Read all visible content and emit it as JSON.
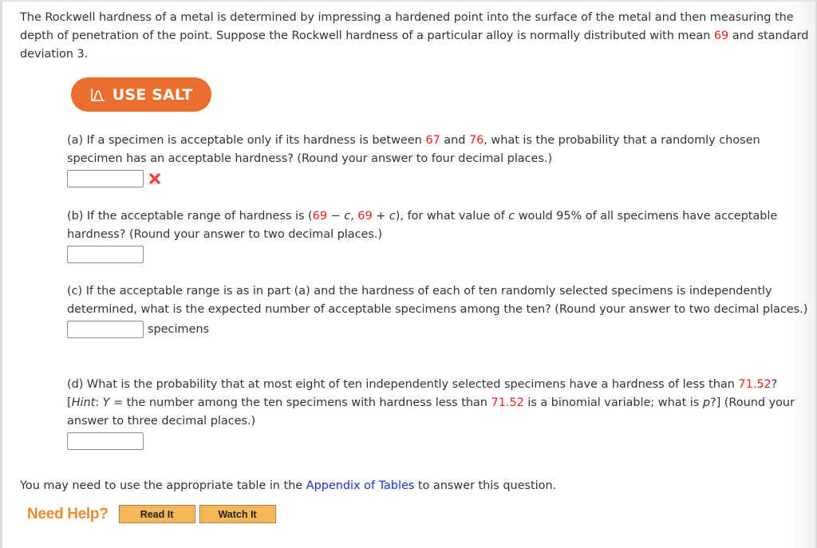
{
  "intro": {
    "text_1": "The Rockwell hardness of a metal is determined by impressing a hardened point into the surface of the metal and then measuring the depth of penetration of the point. Suppose the Rockwell hardness of a particular alloy is normally distributed with mean ",
    "mean": "69",
    "text_2": " and standard deviation 3."
  },
  "salt_button": {
    "label": "USE SALT",
    "icon": "salt-curve-icon"
  },
  "part_a": {
    "text_1": "(a) If a specimen is acceptable only if its hardness is between ",
    "low": "67",
    "text_2": " and ",
    "high": "76",
    "text_3": ", what is the probability that a randomly chosen specimen has an acceptable hardness? (Round your answer to four decimal places.)",
    "answer_value": "",
    "status_icon": "wrong-x-icon",
    "status_color": "#e8474b"
  },
  "part_b": {
    "text_1": "(b) If the acceptable range of hardness is (",
    "mean_1": "69",
    "text_2": " − ",
    "var_1": "c",
    "text_3": ", ",
    "mean_2": "69",
    "text_4": " + ",
    "var_2": "c",
    "text_5": "), for what value of ",
    "var_3": "c",
    "text_6": " would 95% of all specimens have acceptable hardness? (Round your answer to two decimal places.)",
    "answer_value": ""
  },
  "part_c": {
    "text": "(c) If the acceptable range is as in part (a) and the hardness of each of ten randomly selected specimens is independently determined, what is the expected number of acceptable specimens among the ten? (Round your answer to two decimal places.)",
    "answer_value": "",
    "unit": "specimens"
  },
  "part_d": {
    "text_1": "(d) What is the probability that at most eight of ten independently selected specimens have a hardness of less than ",
    "value_1": "71.52",
    "text_2": "? [",
    "hint_label": "Hint",
    "text_3": ": ",
    "var_y": "Y",
    "text_4": " = the number among the ten specimens with hardness less than ",
    "value_2": "71.52",
    "text_5": " is a binomial variable; what is ",
    "var_p": "p",
    "text_6": "?] (Round your answer to three decimal places.)",
    "answer_value": ""
  },
  "appendix": {
    "text_1": "You may need to use the appropriate table in the ",
    "link": "Appendix of Tables",
    "text_2": " to answer this question."
  },
  "help": {
    "label": "Need Help?",
    "buttons": [
      "Read It",
      "Watch It"
    ]
  },
  "colors": {
    "accent_red": "#e8231d",
    "salt_orange": "#ea6f2e",
    "link_blue": "#1a33c4",
    "help_orange": "#e88a2e"
  }
}
